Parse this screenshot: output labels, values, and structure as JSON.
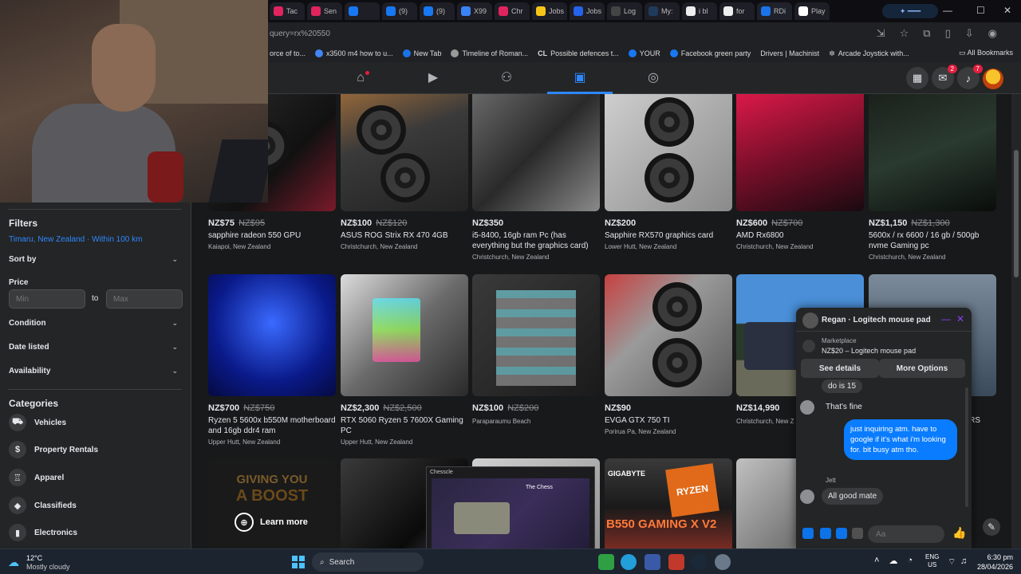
{
  "browser": {
    "tabs": [
      "Tac",
      "Sen",
      "",
      "(9) ",
      "(9) ",
      "X99",
      "Chr",
      "Jobs",
      "Jobs",
      "Log",
      "My:",
      "i bl",
      "for",
      "RDi",
      "Play"
    ],
    "url": "query=rx%20550",
    "bookmarks": [
      "orce of to...",
      "x3500 m4 how to u...",
      "New Tab",
      "Timeline of Roman...",
      "Possible defences t...",
      "YOUR",
      "Facebook green party",
      "Drivers | Machinist",
      "Arcade Joystick with..."
    ],
    "all_bookmarks": "All Bookmarks"
  },
  "fbnav": {
    "messenger_badge": "2",
    "notifications_badge": "7"
  },
  "sidebar": {
    "filters_title": "Filters",
    "location": "Timaru, New Zealand · Within 100 km",
    "sort_by": "Sort by",
    "price_label": "Price",
    "min_placeholder": "Min",
    "max_placeholder": "Max",
    "to_label": "to",
    "condition": "Condition",
    "date_listed": "Date listed",
    "availability": "Availability",
    "categories_title": "Categories",
    "categories": [
      "Vehicles",
      "Property Rentals",
      "Apparel",
      "Classifieds",
      "Electronics"
    ]
  },
  "listings": [
    {
      "price": "NZ$75",
      "old_price": "NZ$95",
      "title": "sapphire radeon 550 GPU",
      "location": "Kaiapoi, New Zealand"
    },
    {
      "price": "NZ$100",
      "old_price": "NZ$120",
      "title": "ASUS ROG Strix RX 470 4GB",
      "location": "Christchurch, New Zealand"
    },
    {
      "price": "NZ$350",
      "old_price": "",
      "title": "i5-8400, 16gb ram Pc (has everything but the graphics card)",
      "location": "Christchurch, New Zealand"
    },
    {
      "price": "NZ$200",
      "old_price": "",
      "title": "Sapphire RX570 graphics card",
      "location": "Lower Hutt, New Zealand"
    },
    {
      "price": "NZ$600",
      "old_price": "NZ$700",
      "title": "AMD Rx6800",
      "location": "Christchurch, New Zealand"
    },
    {
      "price": "NZ$1,150",
      "old_price": "NZ$1,300",
      "title": "5600x / rx 6600 / 16 gb / 500gb nvme Gaming pc",
      "location": "Christchurch, New Zealand"
    },
    {
      "price": "NZ$700",
      "old_price": "NZ$750",
      "title": "Ryzen 5 5600x b550M motherboard and 16gb ddr4 ram",
      "location": "Upper Hutt, New Zealand"
    },
    {
      "price": "NZ$2,300",
      "old_price": "NZ$2,500",
      "title": "RTX 5060 Ryzen 5 7600X Gaming PC",
      "location": "Upper Hutt, New Zealand"
    },
    {
      "price": "NZ$100",
      "old_price": "NZ$200",
      "title": "",
      "location": "Paraparaumu Beach"
    },
    {
      "price": "NZ$90",
      "old_price": "",
      "title": "EVGA GTX 750 TI",
      "location": "Porirua Pa, New Zealand"
    },
    {
      "price": "NZ$14,990",
      "old_price": "",
      "title": "",
      "location": "Christchurch, New Z"
    },
    {
      "price": "",
      "old_price": "",
      "title": "RS",
      "location": ""
    }
  ],
  "ad": {
    "line1": "GIVING YOU",
    "line2": "A BOOST",
    "learn_more": "Learn more"
  },
  "card_texts": {
    "ryzen": "RYZEN",
    "gaming": "B550 GAMING X V2",
    "gigabyte": "GIGABYTE"
  },
  "chat": {
    "name": "Regan · Logitech mouse pad",
    "marketplace_label": "Marketplace",
    "item": "NZ$20 – Logitech mouse pad",
    "see_details": "See details",
    "more_options": "More Options",
    "msg1": "do is 15",
    "msg2": "That's fine",
    "msg_out": "just inquiring atm. have to google if it's what i'm looking for. bit busy atm tho.",
    "sender2": "Jett",
    "msg3": "All good mate",
    "input_placeholder": "Aa"
  },
  "preview": {
    "title": "Chesscle",
    "heading": "The Chess"
  },
  "taskbar": {
    "temperature": "12°C",
    "weather": "Mostly cloudy",
    "search": "Search",
    "lang1": "ENG",
    "lang2": "US",
    "time": "6:30 pm",
    "date": "28/04/2026"
  },
  "colors": {
    "accent": "#2d88ff",
    "messenger_blue": "#0a7cff",
    "badge_red": "#e41e3f"
  }
}
